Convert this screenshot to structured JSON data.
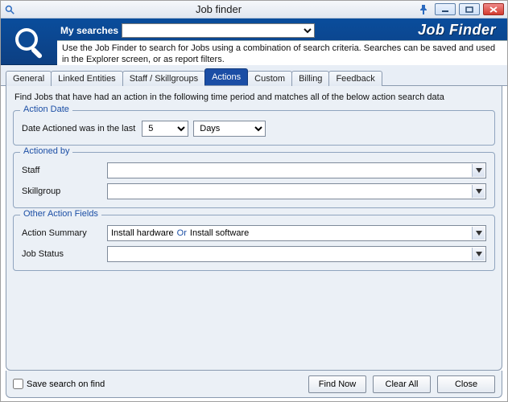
{
  "colors": {
    "accent": "#1b4ea5"
  },
  "titlebar": {
    "title": "Job finder"
  },
  "header": {
    "my_searches_label": "My searches",
    "search_value": "",
    "app_name": "Job Finder",
    "description": "Use the Job Finder to search for Jobs using a combination of search criteria.  Searches can be saved and used in the Explorer screen, or as report filters."
  },
  "tabs": [
    {
      "label": "General",
      "active": false
    },
    {
      "label": "Linked Entities",
      "active": false
    },
    {
      "label": "Staff / Skillgroups",
      "active": false
    },
    {
      "label": "Actions",
      "active": true
    },
    {
      "label": "Custom",
      "active": false
    },
    {
      "label": "Billing",
      "active": false
    },
    {
      "label": "Feedback",
      "active": false
    }
  ],
  "content": {
    "intro": "Find Jobs that have had an action in the following time period and matches all of the below action search data",
    "action_date": {
      "legend": "Action Date",
      "label": "Date Actioned was in the last",
      "number": "5",
      "unit": "Days"
    },
    "actioned_by": {
      "legend": "Actioned by",
      "staff_label": "Staff",
      "staff_value": "",
      "skillgroup_label": "Skillgroup",
      "skillgroup_value": ""
    },
    "other": {
      "legend": "Other Action Fields",
      "summary_label": "Action Summary",
      "summary_value_1": "Install hardware",
      "summary_or": "Or",
      "summary_value_2": "Install software",
      "jobstatus_label": "Job Status",
      "jobstatus_value": ""
    }
  },
  "footer": {
    "save_label": "Save search on find",
    "find_label": "Find Now",
    "clear_label": "Clear All",
    "close_label": "Close"
  }
}
